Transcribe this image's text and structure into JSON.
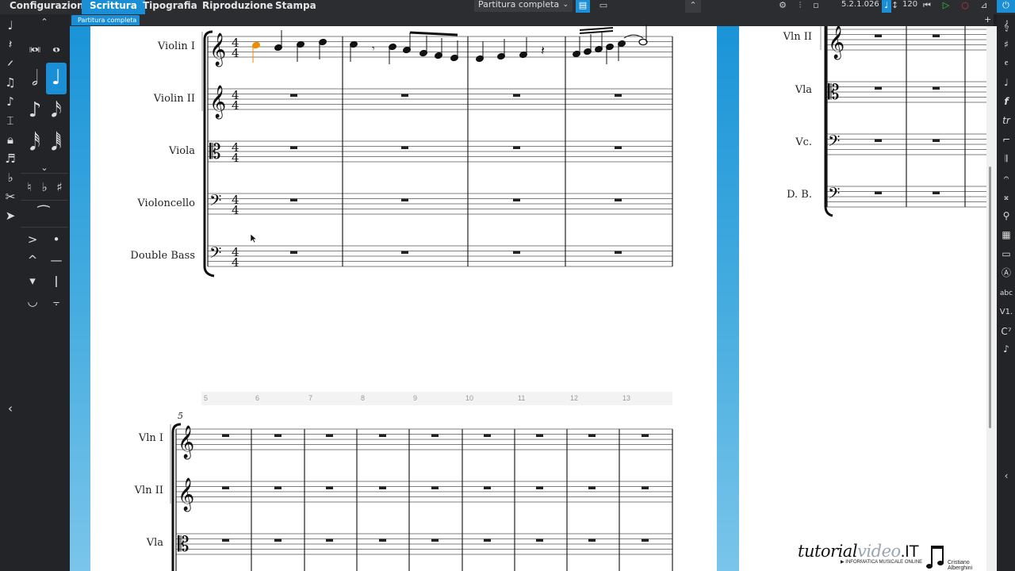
{
  "menu": {
    "items": [
      {
        "label": "Configurazione"
      },
      {
        "label": "Scrittura"
      },
      {
        "label": "Tipografia"
      },
      {
        "label": "Riproduzione"
      },
      {
        "label": "Stampa"
      }
    ],
    "active_index": 1
  },
  "toolbar": {
    "layout_select_value": "Partitura completa",
    "version": "5.2.1.026",
    "tempo": "120"
  },
  "tabs": [
    {
      "label": "Partitura completa"
    }
  ],
  "score": {
    "system1": {
      "instruments": [
        "Violin I",
        "Violin II",
        "Viola",
        "Violoncello",
        "Double Bass"
      ],
      "time_signature": "4/4"
    },
    "measure_numbers": [
      "5",
      "6",
      "7",
      "8",
      "9",
      "10",
      "11",
      "12",
      "13"
    ],
    "system2": {
      "start_measure": "5",
      "instruments": [
        "Vln I",
        "Vln II",
        "Vla"
      ]
    },
    "page2_instruments": [
      "Vln II",
      "Vla",
      "Vc.",
      "D. B."
    ]
  },
  "watermark": {
    "brand_part1": "tutorial",
    "brand_part2": "video",
    "brand_part3": ".IT",
    "subtitle": "INFORMATICA MUSICALE ONLINE",
    "author_first": "Cristiano",
    "author_last": "Alberghini"
  },
  "colors": {
    "accent": "#1a8fd6",
    "selected_note": "#f08a00",
    "page_background": "#1a94d8"
  }
}
